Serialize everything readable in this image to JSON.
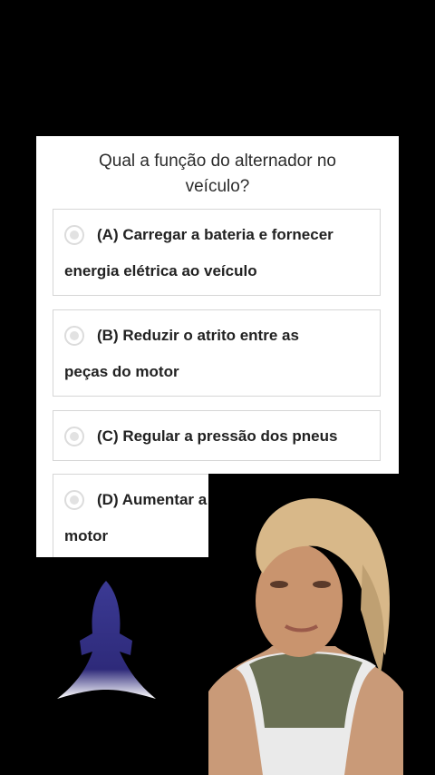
{
  "quiz": {
    "question_line1": "Qual a função do alternador no",
    "question_line2": "veículo?",
    "options": [
      {
        "line1": "(A) Carregar a bateria e fornecer",
        "line2": "energia elétrica ao veículo"
      },
      {
        "line1": "(B) Reduzir o atrito entre as",
        "line2": "peças do motor"
      },
      {
        "line1": "(C) Regular a pressão dos pneus"
      },
      {
        "line1": "(D) Aumentar a potên",
        "line2": "motor"
      }
    ]
  },
  "colors": {
    "background": "#000000",
    "card": "#ffffff",
    "rocket": "#3a3690"
  },
  "icons": {
    "radio": "radio-button-icon",
    "rocket": "rocket-icon"
  }
}
